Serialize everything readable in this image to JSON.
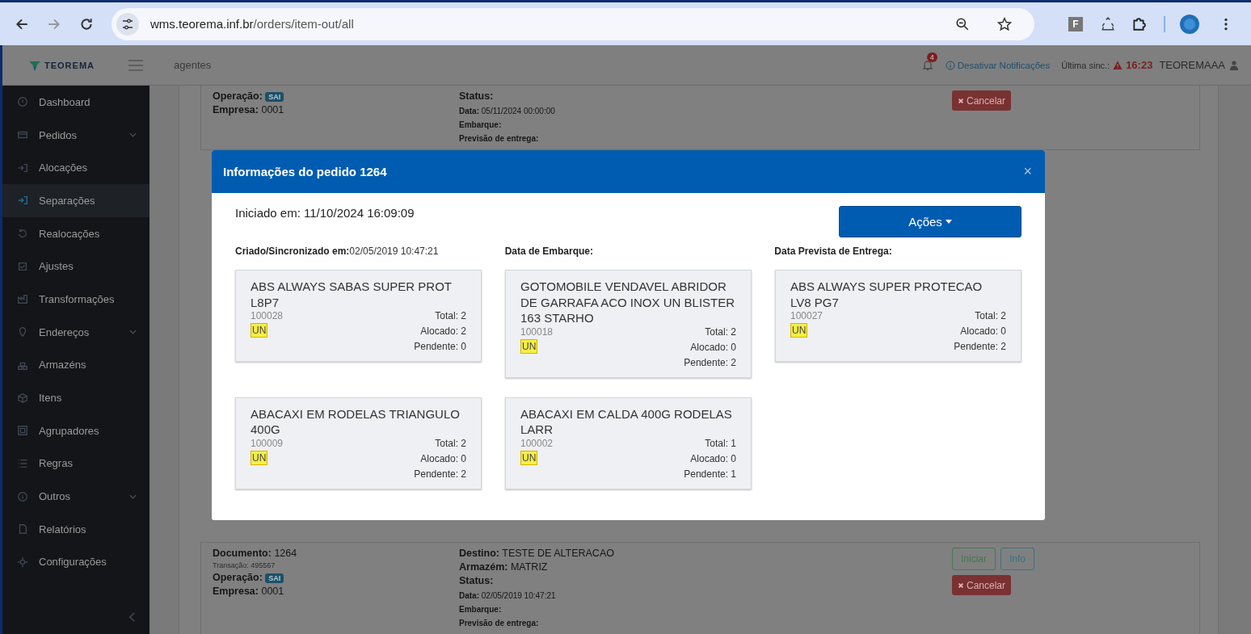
{
  "browser": {
    "url_host": "wms.teorema.inf.br",
    "url_path": "/orders/item-out/all",
    "extension_letter": "F"
  },
  "header": {
    "logo": "TEOREMA",
    "page": "agentes",
    "notification_count": "4",
    "notifications_toggle": "Desativar Notificações",
    "sync_label": "Última sinc.:",
    "sync_time": "16:23",
    "user": "TEOREMAAA"
  },
  "sidebar": {
    "items": [
      {
        "label": "Dashboard",
        "selected": false,
        "submenu": false
      },
      {
        "label": "Pedidos",
        "selected": false,
        "submenu": true
      },
      {
        "label": "Alocações",
        "selected": false,
        "submenu": false
      },
      {
        "label": "Separações",
        "selected": true,
        "submenu": false
      },
      {
        "label": "Realocações",
        "selected": false,
        "submenu": false
      },
      {
        "label": "Ajustes",
        "selected": false,
        "submenu": false
      },
      {
        "label": "Transformações",
        "selected": false,
        "submenu": false
      },
      {
        "label": "Endereços",
        "selected": false,
        "submenu": true
      },
      {
        "label": "Armazéns",
        "selected": false,
        "submenu": false
      },
      {
        "label": "Itens",
        "selected": false,
        "submenu": false
      },
      {
        "label": "Agrupadores",
        "selected": false,
        "submenu": false
      },
      {
        "label": "Regras",
        "selected": false,
        "submenu": false
      },
      {
        "label": "Outros",
        "selected": false,
        "submenu": true
      },
      {
        "label": "Relatórios",
        "selected": false,
        "submenu": false
      },
      {
        "label": "Configurações",
        "selected": false,
        "submenu": false
      }
    ]
  },
  "orders": [
    {
      "left": [
        "**Operação:**",
        "**Empresa:** 0001"
      ],
      "badge": "SAI",
      "right": [
        "**Status:**"
      ],
      "details": [
        "**Data:** 05/11/2024 00:00:00",
        "**Embarque:**",
        "**Previsão de entrega:**"
      ],
      "buttons": [
        {
          "label": "Cancelar",
          "kind": "cancel"
        }
      ]
    },
    {
      "left": [
        "**Documento:** 1264",
        "Transação: 495567",
        "**Operação:**",
        "**Empresa:** 0001"
      ],
      "badge": "SAI",
      "right": [
        "**Destino:** TESTE DE ALTERACAO",
        "**Armazém:** MATRIZ",
        "**Status:**"
      ],
      "details": [
        "**Data:** 02/05/2019 10:47:21",
        "**Embarque:**",
        "**Previsão de entrega:**"
      ],
      "buttons": [
        {
          "label": "Iniciar",
          "kind": "start"
        },
        {
          "label": "Info",
          "kind": "info"
        },
        {
          "label": "Cancelar",
          "kind": "cancel"
        }
      ]
    }
  ],
  "modal": {
    "title": "Informações do pedido 1264",
    "close": "×",
    "started": "Iniciado em: 11/10/2024 16:09:09",
    "actions_button": "Ações",
    "fields": [
      {
        "label": "Criado/Sincronizado em:",
        "value": "02/05/2019 10:47:21"
      },
      {
        "label": "Data de Embarque:"
      },
      {
        "label": "Data Prevista de Entrega:"
      }
    ],
    "items": [
      {
        "name": "ABS ALWAYS SABAS SUPER PROT L8P7",
        "code": "100028",
        "unit": "UN",
        "total": "Total: 2",
        "allocated": "Alocado: 2",
        "pending": "Pendente: 0"
      },
      {
        "name": "GOTOMOBILE VENDAVEL ABRIDOR DE GARRAFA ACO INOX UN BLISTER 163 STARHO",
        "code": "100018",
        "unit": "UN",
        "total": "Total: 2",
        "allocated": "Alocado: 0",
        "pending": "Pendente: 2"
      },
      {
        "name": "ABS ALWAYS SUPER PROTECAO LV8 PG7",
        "code": "100027",
        "unit": "UN",
        "total": "Total: 2",
        "allocated": "Alocado: 0",
        "pending": "Pendente: 2"
      },
      {
        "name": "ABACAXI EM RODELAS TRIANGULO 400G",
        "code": "100009",
        "unit": "UN",
        "total": "Total: 2",
        "allocated": "Alocado: 0",
        "pending": "Pendente: 2"
      },
      {
        "name": "ABACAXI EM CALDA 400G RODELAS LARR",
        "code": "100002",
        "unit": "UN",
        "total": "Total: 1",
        "allocated": "Alocado: 0",
        "pending": "Pendente: 1"
      }
    ]
  }
}
